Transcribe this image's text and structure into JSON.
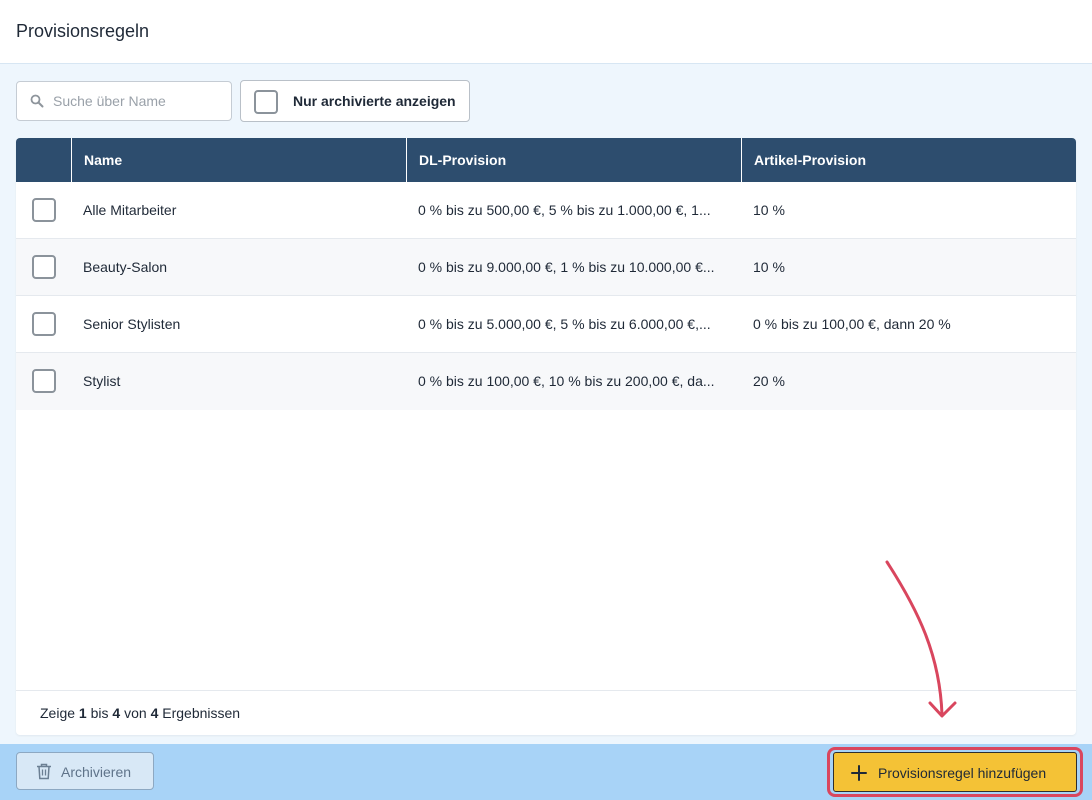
{
  "header": {
    "title": "Provisionsregeln"
  },
  "search": {
    "placeholder": "Suche über Name",
    "value": ""
  },
  "filter": {
    "archived_only_label": "Nur archivierte anzeigen",
    "checked": false
  },
  "table": {
    "columns": [
      "",
      "Name",
      "DL-Provision",
      "Artikel-Provision"
    ],
    "rows": [
      {
        "name": "Alle Mitarbeiter",
        "dl": "0 % bis zu 500,00 €, 5 % bis zu 1.000,00 €, 1...",
        "artikel": "10 %"
      },
      {
        "name": "Beauty-Salon",
        "dl": "0 % bis zu 9.000,00 €, 1 % bis zu 10.000,00 €...",
        "artikel": "10 %"
      },
      {
        "name": "Senior Stylisten",
        "dl": "0 % bis zu 5.000,00 €, 5 % bis zu 6.000,00 €,...",
        "artikel": "0 % bis zu 100,00 €, dann 20 %"
      },
      {
        "name": "Stylist",
        "dl": "0 % bis zu 100,00 €, 10 % bis zu 200,00 €, da...",
        "artikel": "20 %"
      }
    ]
  },
  "pagination": {
    "prefix": "Zeige",
    "from": "1",
    "between": "bis",
    "to": "4",
    "of_word": "von",
    "total": "4",
    "suffix": "Ergebnissen"
  },
  "footer": {
    "archive_label": "Archivieren",
    "add_label": "Provisionsregel hinzufügen"
  },
  "icons": {
    "search": "search-icon",
    "trash": "trash-icon",
    "plus": "plus-icon",
    "arrow": "annotation-arrow"
  },
  "colors": {
    "table_header": "#2d4d6e",
    "primary_button": "#f4c236",
    "highlight": "#d9465e",
    "bottom_bar": "#a8d3f7"
  }
}
